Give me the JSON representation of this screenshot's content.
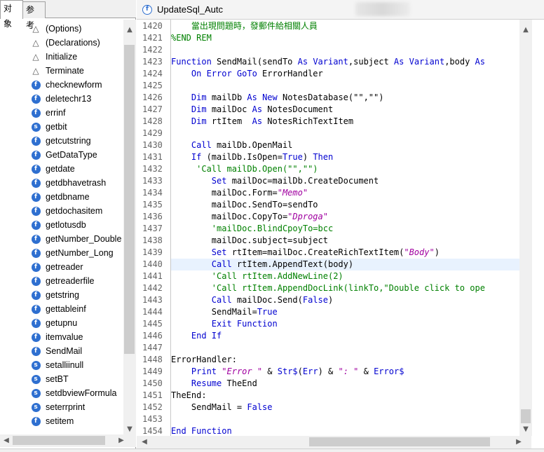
{
  "left_panel": {
    "tabs": [
      {
        "label": "对象",
        "active": true
      },
      {
        "label": "参考",
        "active": false
      }
    ],
    "items": [
      {
        "icon": "triangle",
        "label": "(Options)"
      },
      {
        "icon": "triangle",
        "label": "(Declarations)"
      },
      {
        "icon": "triangle",
        "label": "Initialize"
      },
      {
        "icon": "triangle",
        "label": "Terminate"
      },
      {
        "icon": "function",
        "label": "checknewform"
      },
      {
        "icon": "function",
        "label": "deletechr13"
      },
      {
        "icon": "function",
        "label": "errinf"
      },
      {
        "icon": "sub",
        "label": "getbit"
      },
      {
        "icon": "function",
        "label": "getcutstring"
      },
      {
        "icon": "function",
        "label": "GetDataType"
      },
      {
        "icon": "function",
        "label": "getdate"
      },
      {
        "icon": "function",
        "label": "getdbhavetrash"
      },
      {
        "icon": "function",
        "label": "getdbname"
      },
      {
        "icon": "function",
        "label": "getdochasitem"
      },
      {
        "icon": "function",
        "label": "getlotusdb"
      },
      {
        "icon": "function",
        "label": "getNumber_Double"
      },
      {
        "icon": "function",
        "label": "getNumber_Long"
      },
      {
        "icon": "function",
        "label": "getreader"
      },
      {
        "icon": "function",
        "label": "getreaderfile"
      },
      {
        "icon": "function",
        "label": "getstring"
      },
      {
        "icon": "function",
        "label": "gettableinf"
      },
      {
        "icon": "function",
        "label": "getupnu"
      },
      {
        "icon": "function",
        "label": "itemvalue"
      },
      {
        "icon": "function",
        "label": "SendMail"
      },
      {
        "icon": "sub",
        "label": "setalliinull"
      },
      {
        "icon": "sub",
        "label": "setBT"
      },
      {
        "icon": "sub",
        "label": "setdbviewFormula"
      },
      {
        "icon": "sub",
        "label": "seterrprint"
      },
      {
        "icon": "function",
        "label": "setitem"
      }
    ],
    "icons": {
      "triangle": "△",
      "function": "f",
      "sub": "s"
    }
  },
  "editor": {
    "tab_title": "UpdateSql_Autc",
    "tab_icon": "function-icon",
    "highlight_line": 1440,
    "lines": [
      {
        "n": "1420",
        "tokens": [
          {
            "t": "    當出現問題時，發郵件給相關人員",
            "c": "cm"
          }
        ]
      },
      {
        "n": "1421",
        "tokens": [
          {
            "t": "%END REM",
            "c": "cm"
          }
        ]
      },
      {
        "n": "1422",
        "tokens": []
      },
      {
        "n": "1423",
        "tokens": [
          {
            "t": "Function",
            "c": "kw"
          },
          {
            "t": " SendMail(sendTo ",
            "c": "tx"
          },
          {
            "t": "As",
            "c": "kw"
          },
          {
            "t": " ",
            "c": "tx"
          },
          {
            "t": "Variant",
            "c": "kw"
          },
          {
            "t": ",subject ",
            "c": "tx"
          },
          {
            "t": "As",
            "c": "kw"
          },
          {
            "t": " ",
            "c": "tx"
          },
          {
            "t": "Variant",
            "c": "kw"
          },
          {
            "t": ",body ",
            "c": "tx"
          },
          {
            "t": "As",
            "c": "kw"
          }
        ]
      },
      {
        "n": "1424",
        "tokens": [
          {
            "t": "    ",
            "c": "tx"
          },
          {
            "t": "On Error GoTo",
            "c": "kw"
          },
          {
            "t": " ErrorHandler",
            "c": "tx"
          }
        ]
      },
      {
        "n": "1425",
        "tokens": []
      },
      {
        "n": "1426",
        "tokens": [
          {
            "t": "    ",
            "c": "tx"
          },
          {
            "t": "Dim",
            "c": "kw"
          },
          {
            "t": " mailDb ",
            "c": "tx"
          },
          {
            "t": "As New",
            "c": "kw"
          },
          {
            "t": " NotesDatabase(\"\",\"\")",
            "c": "tx"
          }
        ]
      },
      {
        "n": "1427",
        "tokens": [
          {
            "t": "    ",
            "c": "tx"
          },
          {
            "t": "Dim",
            "c": "kw"
          },
          {
            "t": " mailDoc ",
            "c": "tx"
          },
          {
            "t": "As",
            "c": "kw"
          },
          {
            "t": " NotesDocument",
            "c": "tx"
          }
        ]
      },
      {
        "n": "1428",
        "tokens": [
          {
            "t": "    ",
            "c": "tx"
          },
          {
            "t": "Dim",
            "c": "kw"
          },
          {
            "t": " rtItem  ",
            "c": "tx"
          },
          {
            "t": "As",
            "c": "kw"
          },
          {
            "t": " NotesRichTextItem",
            "c": "tx"
          }
        ]
      },
      {
        "n": "1429",
        "tokens": []
      },
      {
        "n": "1430",
        "tokens": [
          {
            "t": "    ",
            "c": "tx"
          },
          {
            "t": "Call",
            "c": "kw"
          },
          {
            "t": " mailDb.OpenMail",
            "c": "tx"
          }
        ]
      },
      {
        "n": "1431",
        "tokens": [
          {
            "t": "    ",
            "c": "tx"
          },
          {
            "t": "If",
            "c": "kw"
          },
          {
            "t": " (mailDb.IsOpen=",
            "c": "tx"
          },
          {
            "t": "True",
            "c": "kw"
          },
          {
            "t": ") ",
            "c": "tx"
          },
          {
            "t": "Then",
            "c": "kw"
          }
        ]
      },
      {
        "n": "1432",
        "tokens": [
          {
            "t": "     'Call mailDb.Open(\"\",\"\")",
            "c": "cm"
          }
        ]
      },
      {
        "n": "1433",
        "tokens": [
          {
            "t": "        ",
            "c": "tx"
          },
          {
            "t": "Set",
            "c": "kw"
          },
          {
            "t": " mailDoc=mailDb.CreateDocument",
            "c": "tx"
          }
        ]
      },
      {
        "n": "1434",
        "tokens": [
          {
            "t": "        mailDoc.Form=",
            "c": "tx"
          },
          {
            "t": "\"Memo\"",
            "c": "st"
          }
        ]
      },
      {
        "n": "1435",
        "tokens": [
          {
            "t": "        mailDoc.SendTo=sendTo",
            "c": "tx"
          }
        ]
      },
      {
        "n": "1436",
        "tokens": [
          {
            "t": "        mailDoc.CopyTo=",
            "c": "tx"
          },
          {
            "t": "\"Dproga\"",
            "c": "st"
          }
        ]
      },
      {
        "n": "1437",
        "tokens": [
          {
            "t": "        'mailDoc.BlindCpoyTo=bcc",
            "c": "cm"
          }
        ]
      },
      {
        "n": "1438",
        "tokens": [
          {
            "t": "        mailDoc.subject=subject",
            "c": "tx"
          }
        ]
      },
      {
        "n": "1439",
        "tokens": [
          {
            "t": "        ",
            "c": "tx"
          },
          {
            "t": "Set",
            "c": "kw"
          },
          {
            "t": " rtItem=mailDoc.CreateRichTextItem(",
            "c": "tx"
          },
          {
            "t": "\"Body\"",
            "c": "st"
          },
          {
            "t": ")",
            "c": "tx"
          }
        ]
      },
      {
        "n": "1440",
        "tokens": [
          {
            "t": "        ",
            "c": "tx"
          },
          {
            "t": "Call",
            "c": "kw"
          },
          {
            "t": " rtItem.AppendText(body)",
            "c": "tx"
          }
        ]
      },
      {
        "n": "1441",
        "tokens": [
          {
            "t": "        'Call rtItem.AddNewLine(2)",
            "c": "cm"
          }
        ]
      },
      {
        "n": "1442",
        "tokens": [
          {
            "t": "        'Call rtItem.AppendDocLink(linkTo,\"Double click to ope",
            "c": "cm"
          }
        ]
      },
      {
        "n": "1443",
        "tokens": [
          {
            "t": "        ",
            "c": "tx"
          },
          {
            "t": "Call",
            "c": "kw"
          },
          {
            "t": " mailDoc.Send(",
            "c": "tx"
          },
          {
            "t": "False",
            "c": "kw"
          },
          {
            "t": ")",
            "c": "tx"
          }
        ]
      },
      {
        "n": "1444",
        "tokens": [
          {
            "t": "        SendMail=",
            "c": "tx"
          },
          {
            "t": "True",
            "c": "kw"
          }
        ]
      },
      {
        "n": "1445",
        "tokens": [
          {
            "t": "        ",
            "c": "tx"
          },
          {
            "t": "Exit Function",
            "c": "kw"
          }
        ]
      },
      {
        "n": "1446",
        "tokens": [
          {
            "t": "    ",
            "c": "tx"
          },
          {
            "t": "End If",
            "c": "kw"
          }
        ]
      },
      {
        "n": "1447",
        "tokens": []
      },
      {
        "n": "1448",
        "tokens": [
          {
            "t": "ErrorHandler:",
            "c": "tx"
          }
        ]
      },
      {
        "n": "1449",
        "tokens": [
          {
            "t": "    ",
            "c": "tx"
          },
          {
            "t": "Print",
            "c": "kw"
          },
          {
            "t": " ",
            "c": "tx"
          },
          {
            "t": "\"Error \"",
            "c": "st"
          },
          {
            "t": " & ",
            "c": "tx"
          },
          {
            "t": "Str$",
            "c": "kw"
          },
          {
            "t": "(",
            "c": "tx"
          },
          {
            "t": "Err",
            "c": "kw"
          },
          {
            "t": ") & ",
            "c": "tx"
          },
          {
            "t": "\": \"",
            "c": "st"
          },
          {
            "t": " & ",
            "c": "tx"
          },
          {
            "t": "Error$",
            "c": "kw"
          }
        ]
      },
      {
        "n": "1450",
        "tokens": [
          {
            "t": "    ",
            "c": "tx"
          },
          {
            "t": "Resume",
            "c": "kw"
          },
          {
            "t": " TheEnd",
            "c": "tx"
          }
        ]
      },
      {
        "n": "1451",
        "tokens": [
          {
            "t": "TheEnd:",
            "c": "tx"
          }
        ]
      },
      {
        "n": "1452",
        "tokens": [
          {
            "t": "    SendMail = ",
            "c": "tx"
          },
          {
            "t": "False",
            "c": "kw"
          }
        ]
      },
      {
        "n": "1453",
        "tokens": []
      },
      {
        "n": "1454",
        "tokens": [
          {
            "t": "End Function",
            "c": "kw"
          }
        ]
      }
    ]
  },
  "colors": {
    "keyword": "#0000d0",
    "comment": "#008000",
    "string": "#a000a0",
    "line_highlight": "#e8f2fe"
  }
}
